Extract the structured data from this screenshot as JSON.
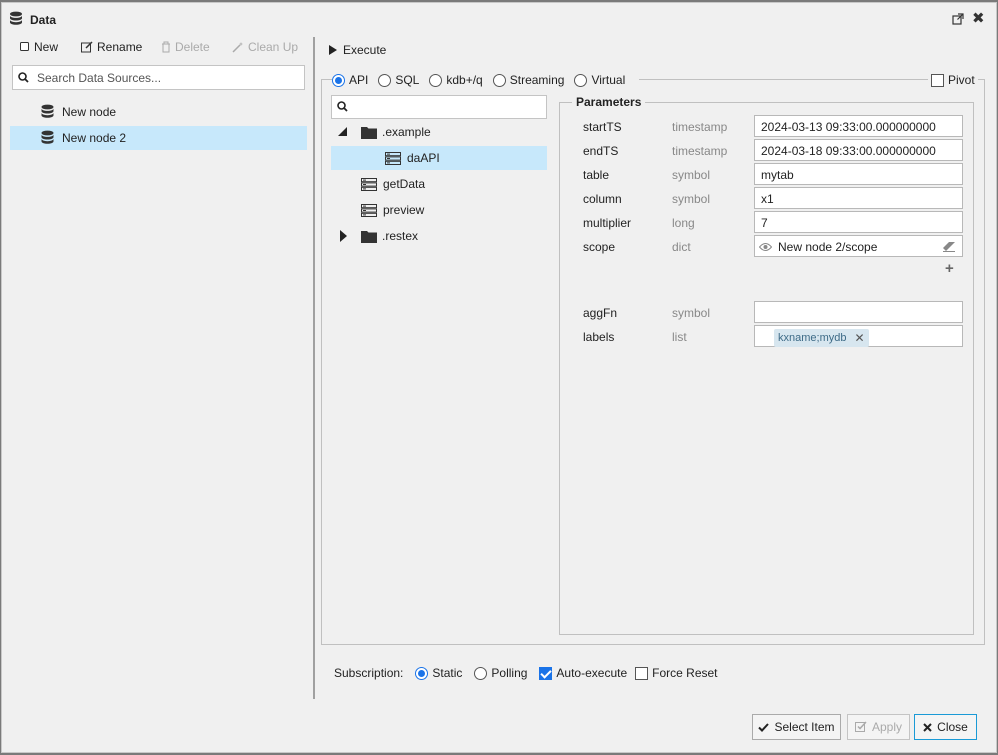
{
  "window": {
    "title": "Data"
  },
  "left_toolbar": {
    "new_label": "New",
    "rename_label": "Rename",
    "delete_label": "Delete",
    "cleanup_label": "Clean Up"
  },
  "search": {
    "placeholder": "Search Data Sources..."
  },
  "nodes": [
    {
      "label": "New node",
      "selected": false
    },
    {
      "label": "New node 2",
      "selected": true
    }
  ],
  "execute_label": "Execute",
  "source_types": {
    "api": "API",
    "sql": "SQL",
    "kdbq": "kdb+/q",
    "streaming": "Streaming",
    "virtual": "Virtual",
    "selected": "API"
  },
  "pivot_label": "Pivot",
  "tree": {
    "search_placeholder": "",
    "items": [
      {
        "label": ".example",
        "type": "folder",
        "expanded": true
      },
      {
        "label": "daAPI",
        "type": "function",
        "selected": true
      },
      {
        "label": "getData",
        "type": "function"
      },
      {
        "label": "preview",
        "type": "function"
      },
      {
        "label": ".restex",
        "type": "folder",
        "expanded": false
      }
    ]
  },
  "parameters": {
    "title": "Parameters",
    "rows": [
      {
        "name": "startTS",
        "type": "timestamp",
        "value": "2024-03-13 09:33:00.000000000"
      },
      {
        "name": "endTS",
        "type": "timestamp",
        "value": "2024-03-18 09:33:00.000000000"
      },
      {
        "name": "table",
        "type": "symbol",
        "value": "mytab"
      },
      {
        "name": "column",
        "type": "symbol",
        "value": "x1"
      },
      {
        "name": "multiplier",
        "type": "long",
        "value": "7"
      },
      {
        "name": "scope",
        "type": "dict",
        "value": "New node 2/scope"
      },
      {
        "name": "aggFn",
        "type": "symbol",
        "value": ""
      },
      {
        "name": "labels",
        "type": "list",
        "tag": "kxname;mydb"
      }
    ]
  },
  "subscription": {
    "label": "Subscription:",
    "static_label": "Static",
    "polling_label": "Polling",
    "selected": "Static",
    "auto_execute_label": "Auto-execute",
    "auto_execute_checked": true,
    "force_reset_label": "Force Reset",
    "force_reset_checked": false
  },
  "buttons": {
    "select_item": "Select Item",
    "apply": "Apply",
    "close": "Close"
  },
  "colors": {
    "accent": "#1a73e8",
    "selection": "#c7e8fb",
    "tag_bg": "#d7e6ef"
  }
}
